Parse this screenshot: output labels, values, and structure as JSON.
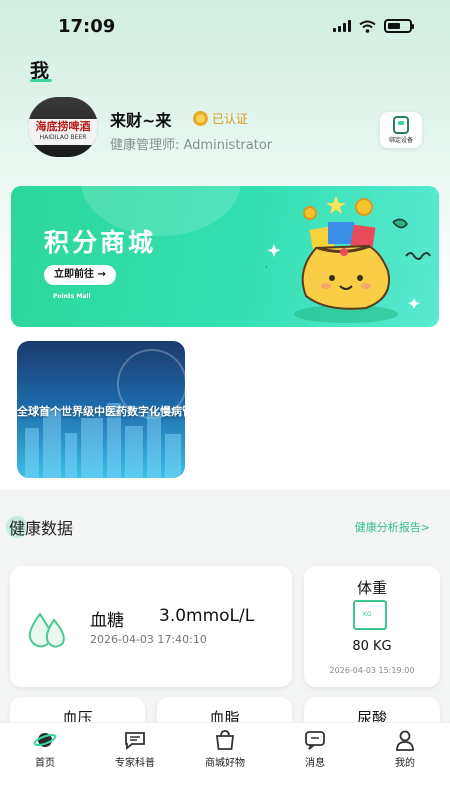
{
  "status_bar": {
    "time": "17:09"
  },
  "page": {
    "title": "我"
  },
  "user": {
    "name": "来财~来",
    "verified_label": "已认证",
    "role": "健康管理师:  Administrator",
    "avatar_text": "海底捞啤酒",
    "avatar_subtext": "HAIDILAO BEER"
  },
  "bind_device": {
    "label": "绑定设备"
  },
  "banner": {
    "title": "积分商城",
    "button": "立即前往 →",
    "subtitle": "Points Mall"
  },
  "promo": {
    "text": "全球首个世界级中医药数字化慢病管理平台"
  },
  "health": {
    "section_title": "健康数据",
    "report_link": "健康分析报告>",
    "blood_sugar": {
      "label": "血糖",
      "value": "3.0mmoL/L",
      "time": "2026-04-03 17:40:10"
    },
    "weight": {
      "label": "体重",
      "value": "80 KG",
      "time": "2026-04-03 15:19:00"
    },
    "blood_pressure": {
      "label": "血压"
    },
    "blood_lipid": {
      "label": "血脂"
    },
    "uric_acid": {
      "label": "尿酸"
    }
  },
  "tabbar": {
    "home": "首页",
    "science": "专家科普",
    "mall": "商城好物",
    "messages": "消息",
    "mine": "我的"
  },
  "colors": {
    "accent": "#3bd6a0",
    "link": "#33c08b",
    "verified": "#d89a22"
  }
}
